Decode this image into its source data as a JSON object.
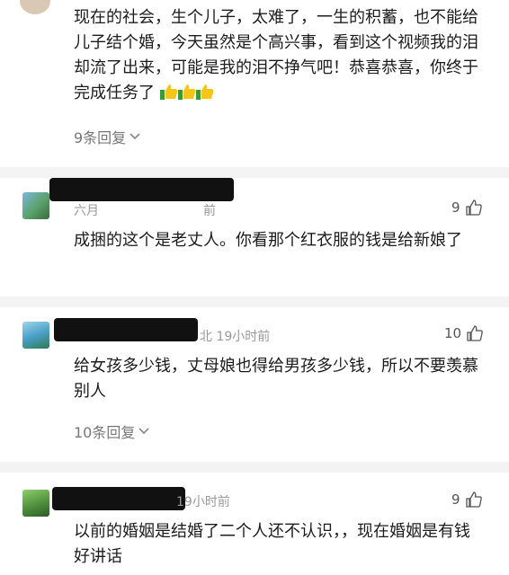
{
  "comments": [
    {
      "text": "现在的社会，生个儿子，太难了，一生的积蓄，也不能给儿子结个婚，今天虽然是个高兴事，看到这个视频我的泪却流了出来，可能是我的泪不挣气吧！恭喜恭喜，你终于完成任务了",
      "emoji": [
        "thumbs-up-icon",
        "thumbs-up-icon",
        "thumbs-up-icon"
      ],
      "replies": "9条回复"
    },
    {
      "meta": "六月",
      "meta2": "前",
      "likes": "9",
      "text": "成捆的这个是老丈人。你看那个红衣服的钱是给新娘了"
    },
    {
      "meta": "北 19小时前",
      "likes": "10",
      "text": "给女孩多少钱，丈母娘也得给男孩多少钱，所以不要羡慕别人",
      "replies": "10条回复"
    },
    {
      "meta": "19小时前",
      "likes": "9",
      "text": "以前的婚姻是结婚了二个人还不认识，，现在婚姻是有钱好讲话"
    }
  ],
  "colors": {
    "separator": "#f3f3f3",
    "meta": "#9a9a9a",
    "redaction": "#111111"
  }
}
